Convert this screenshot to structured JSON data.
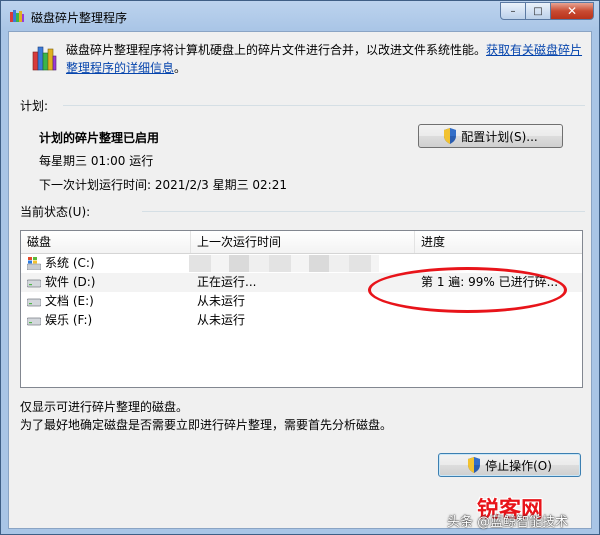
{
  "window": {
    "title": "磁盘碎片整理程序",
    "minimize_glyph": "–",
    "maximize_glyph": "□",
    "close_glyph": "✕"
  },
  "intro": {
    "text": "磁盘碎片整理程序将计算机硬盘上的碎片文件进行合并，以改进文件系统性能。",
    "link": "获取有关磁盘碎片整理程序的详细信息",
    "link_end": "。"
  },
  "schedule": {
    "label": "计划:",
    "title": "计划的碎片整理已启用",
    "frequency": "每星期三  01:00 运行",
    "next_run": "下一次计划运行时间: 2021/2/3 星期三 02:21",
    "configure_button": "配置计划(S)..."
  },
  "status": {
    "label": "当前状态(U):",
    "columns": [
      "磁盘",
      "上一次运行时间",
      "进度"
    ],
    "rows": [
      {
        "disk": "系统 (C:)",
        "last_run": "",
        "progress": "",
        "icon": "windows-drive-icon"
      },
      {
        "disk": "软件 (D:)",
        "last_run": "正在运行...",
        "progress": "第 1 遍: 99% 已进行碎...",
        "icon": "hard-drive-icon"
      },
      {
        "disk": "文档 (E:)",
        "last_run": "从未运行",
        "progress": "",
        "icon": "hard-drive-icon"
      },
      {
        "disk": "娱乐 (F:)",
        "last_run": "从未运行",
        "progress": "",
        "icon": "hard-drive-icon"
      }
    ]
  },
  "notes": {
    "line1": "仅显示可进行碎片整理的磁盘。",
    "line2": "为了最好地确定磁盘是否需要立即进行碎片整理，需要首先分析磁盘。"
  },
  "actions": {
    "stop_button": "停止操作(O)"
  },
  "watermark": {
    "logo": "锐客网",
    "text": "头条 @蓝鲸智能技术"
  },
  "colors": {
    "accent": "#0645ad",
    "highlight": "#e8141a"
  }
}
